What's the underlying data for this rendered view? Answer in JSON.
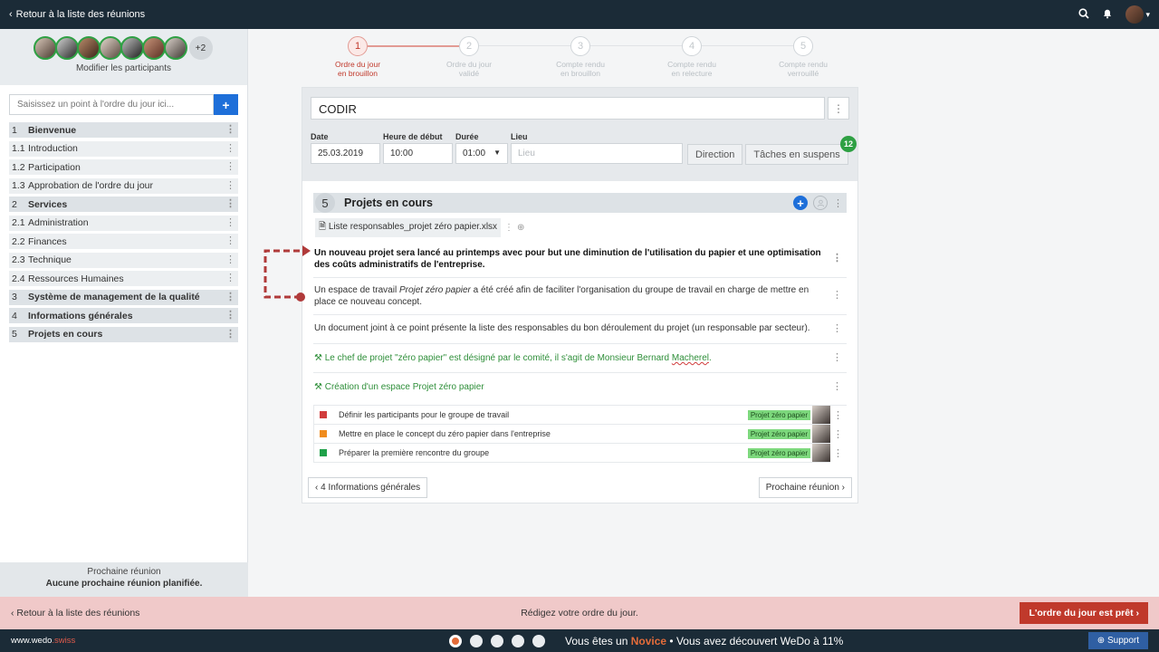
{
  "topbar": {
    "back_label": "Retour à la liste des réunions"
  },
  "sidebar": {
    "participants_more": "+2",
    "participants_label": "Modifier les participants",
    "agenda_placeholder": "Saisissez un point à l'ordre du jour ici...",
    "agenda": [
      {
        "num": "1",
        "label": "Bienvenue",
        "main": true
      },
      {
        "num": "1.1",
        "label": "Introduction",
        "main": false
      },
      {
        "num": "1.2",
        "label": "Participation",
        "main": false
      },
      {
        "num": "1.3",
        "label": "Approbation de l'ordre du jour",
        "main": false
      },
      {
        "num": "2",
        "label": "Services",
        "main": true
      },
      {
        "num": "2.1",
        "label": "Administration",
        "main": false
      },
      {
        "num": "2.2",
        "label": "Finances",
        "main": false
      },
      {
        "num": "2.3",
        "label": "Technique",
        "main": false
      },
      {
        "num": "2.4",
        "label": "Ressources Humaines",
        "main": false
      },
      {
        "num": "3",
        "label": "Système de management de la qualité",
        "main": true
      },
      {
        "num": "4",
        "label": "Informations générales",
        "main": true
      },
      {
        "num": "5",
        "label": "Projets en cours",
        "main": true
      }
    ],
    "next_meeting_title": "Prochaine réunion",
    "next_meeting_value": "Aucune prochaine réunion planifiée."
  },
  "steps": [
    {
      "num": "1",
      "line1": "Ordre du jour",
      "line2": "en brouillon",
      "active": true
    },
    {
      "num": "2",
      "line1": "Ordre du jour",
      "line2": "validé",
      "active": false
    },
    {
      "num": "3",
      "line1": "Compte rendu",
      "line2": "en brouillon",
      "active": false
    },
    {
      "num": "4",
      "line1": "Compte rendu",
      "line2": "en relecture",
      "active": false
    },
    {
      "num": "5",
      "line1": "Compte rendu",
      "line2": "verrouillé",
      "active": false
    }
  ],
  "meeting": {
    "title": "CODIR",
    "date_label": "Date",
    "date_value": "25.03.2019",
    "start_label": "Heure de début",
    "start_value": "10:00",
    "duration_label": "Durée",
    "duration_value": "01:00",
    "place_label": "Lieu",
    "place_placeholder": "Lieu",
    "direction_label": "Direction",
    "pending_label": "Tâches en suspens",
    "pending_count": "12"
  },
  "section": {
    "num": "5",
    "title": "Projets en cours",
    "file_name": "Liste responsables_projet zéro papier.xlsx",
    "para1": "Un nouveau projet sera lancé au printemps avec pour but une diminution de l'utilisation du papier et une optimisation des coûts administratifs de l'entreprise.",
    "para2_a": "Un espace de travail ",
    "para2_em": "Projet zéro papier",
    "para2_b": " a été créé afin de faciliter l'organisation du groupe de travail en charge de mettre en place ce nouveau concept.",
    "para3": "Un document joint à ce point présente la liste des responsables du bon déroulement du projet (un responsable par secteur).",
    "decision1_a": "Le chef de projet \"zéro papier\" est désigné par le comité, il s'agit de Monsieur Bernard ",
    "decision1_b": "Macherel",
    "decision1_c": ".",
    "decision2": "Création d'un espace Projet zéro papier",
    "tasks": [
      {
        "label": "Définir les participants pour le groupe de travail",
        "tag": "Projet zéro papier",
        "color": "#d13c3c"
      },
      {
        "label": "Mettre en place le concept du zéro papier dans l'entreprise",
        "tag": "Projet zéro papier",
        "color": "#f08c1e"
      },
      {
        "label": "Préparer la première rencontre du groupe",
        "tag": "Projet zéro papier",
        "color": "#1fa149"
      }
    ]
  },
  "nav": {
    "prev_label": "4 Informations générales",
    "next_label": "Prochaine réunion"
  },
  "bottom": {
    "back_label": "Retour à la liste des réunions",
    "center_text": "Rédigez votre ordre du jour.",
    "ready_label": "L'ordre du jour est prêt"
  },
  "footer": {
    "brand": "www.wedo",
    "brand_suffix": ".swiss",
    "msg_a": "Vous êtes un ",
    "msg_level": "Novice",
    "msg_b": " • Vous avez découvert WeDo à 11%",
    "support_label": "Support"
  },
  "colors": {
    "accent": "#1e6fd9",
    "brand_dark": "#1b2b37",
    "danger": "#c0392b",
    "success": "#2ea043"
  }
}
